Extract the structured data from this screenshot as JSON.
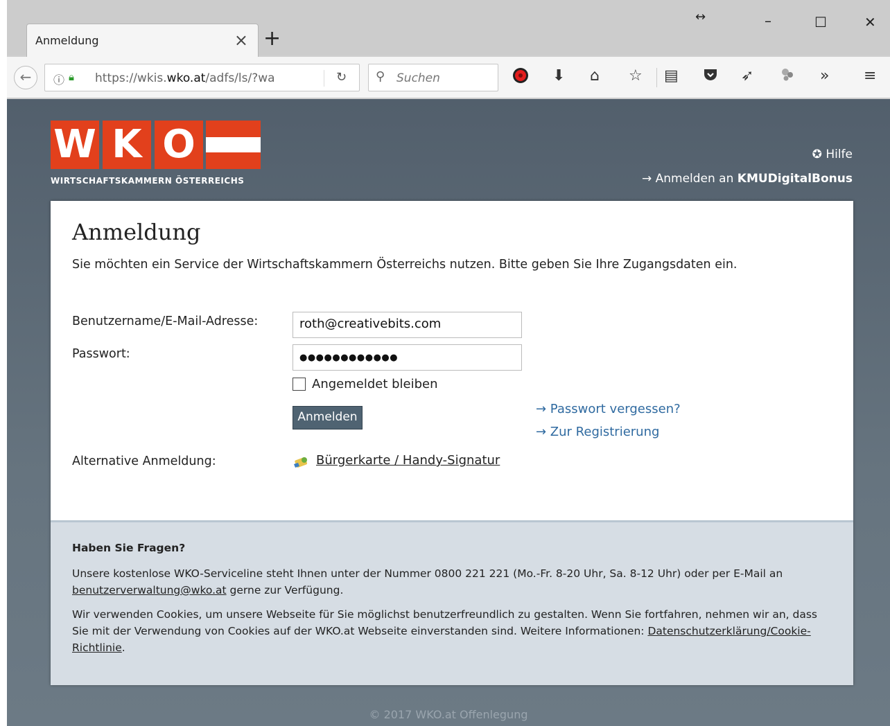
{
  "browser": {
    "tab_title": "Anmeldung",
    "tab_close": "×",
    "new_tab": "+",
    "resize_glyph": "↔",
    "minimize": "–",
    "maximize": "☐",
    "close": "✕",
    "url_prefix": "https://wkis.",
    "url_domain": "wko.at",
    "url_path": "/adfs/ls/?wa",
    "search_placeholder": "Suchen",
    "icons": [
      "back-icon",
      "info-icon",
      "lock-icon",
      "reload-icon",
      "search-icon",
      "record-icon",
      "download-icon",
      "home-icon",
      "bookmark-star-icon",
      "reading-list-icon",
      "pocket-icon",
      "send-icon",
      "extension-icon",
      "overflow-icon",
      "menu-icon"
    ]
  },
  "header": {
    "logo_letters": [
      "W",
      "K",
      "O"
    ],
    "logo_caption": "WIRTSCHAFTSKAMMERN ÖSTERREICHS",
    "help_label": "Hilfe",
    "kmu_prefix": "→ Anmelden an ",
    "kmu_name": "KMUDigitalBonus"
  },
  "login": {
    "title": "Anmeldung",
    "intro": "Sie möchten ein Service der Wirtschaftskammern Österreichs nutzen. Bitte geben Sie Ihre Zugangsdaten ein.",
    "username_label": "Benutzername/E-Mail-Adresse:",
    "username_value": "roth@creativebits.com",
    "password_label": "Passwort:",
    "password_value": "●●●●●●●●●●●●",
    "remember_label": "Angemeldet bleiben",
    "submit_label": "Anmelden",
    "forgot_link": "→ Passwort vergessen?",
    "register_link": "→ Zur Registrierung",
    "alt_label": "Alternative Anmeldung:",
    "alt_link": "Bürgerkarte / Handy-Signatur"
  },
  "footer": {
    "heading": "Haben Sie Fragen?",
    "service_text_1": "Unsere kostenlose WKO-Serviceline steht Ihnen unter der Nummer 0800 221 221 (Mo.-Fr. 8-20 Uhr, Sa. 8-12 Uhr) oder per E-Mail an ",
    "service_email": "benutzerverwaltung@wko.at",
    "service_text_2": " gerne zur Verfügung.",
    "cookie_text": "Wir verwenden Cookies, um unsere Webseite für Sie möglichst benutzerfreundlich zu gestalten. Wenn Sie fortfahren, nehmen wir an, dass Sie mit der Verwendung von Cookies auf der WKO.at Webseite einverstanden sind. Weitere Informationen: ",
    "cookie_link": "Datenschutzerklärung/Cookie-Richtlinie",
    "cookie_end": ".",
    "copyright": "© 2017 WKO.at Offenlegung"
  },
  "colors": {
    "brand_red": "#e2401c",
    "page_bg": "#5e6b77",
    "link_blue": "#2f6aa0",
    "button_bg": "#4f6372",
    "footer_bg": "#d6dde4"
  }
}
